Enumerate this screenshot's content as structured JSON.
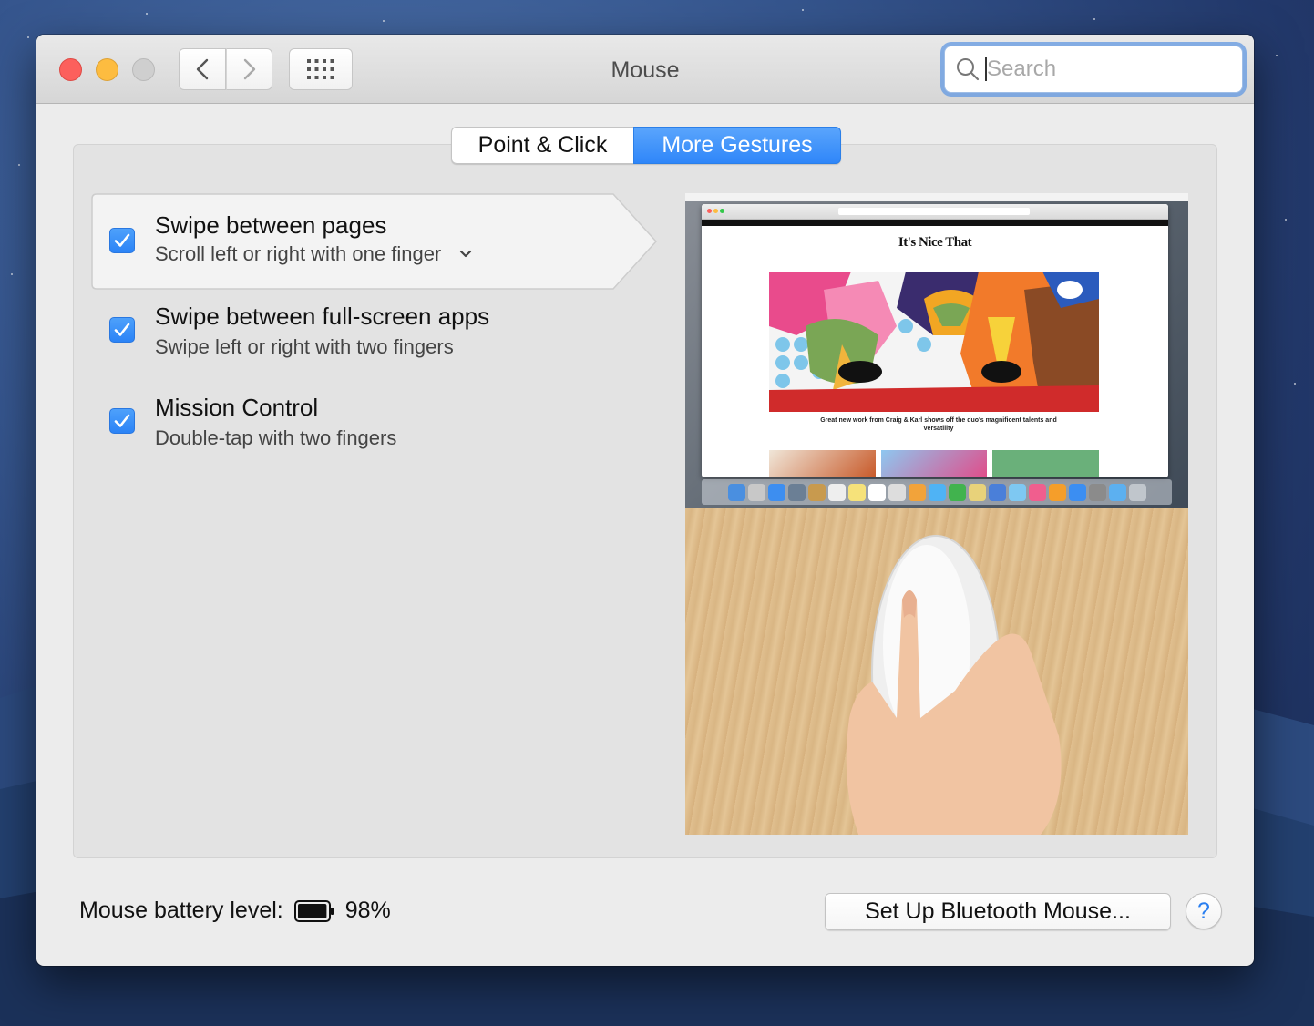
{
  "window": {
    "title": "Mouse"
  },
  "toolbar": {
    "search_placeholder": "Search"
  },
  "tabs": [
    {
      "label": "Point & Click",
      "selected": false
    },
    {
      "label": "More Gestures",
      "selected": true
    }
  ],
  "gestures": [
    {
      "title": "Swipe between pages",
      "subtitle": "Scroll left or right with one finger",
      "checked": true,
      "selected": true,
      "has_dropdown": true
    },
    {
      "title": "Swipe between full-screen apps",
      "subtitle": "Swipe left or right with two fingers",
      "checked": true,
      "selected": false
    },
    {
      "title": "Mission Control",
      "subtitle": "Double-tap with two fingers",
      "checked": true,
      "selected": false
    }
  ],
  "preview": {
    "site_logo": "It's Nice That",
    "caption": "Great new work from Craig & Karl shows off the duo's magnificent talents and versatility"
  },
  "battery": {
    "label": "Mouse battery level:",
    "percent": "98%",
    "level": 0.98
  },
  "buttons": {
    "setup_label": "Set Up Bluetooth Mouse...",
    "help_label": "?"
  },
  "colors": {
    "accent": "#2f86f9",
    "close": "#fc605c",
    "minimize": "#fdbc40",
    "zoom_disabled": "#cfcfcf"
  }
}
